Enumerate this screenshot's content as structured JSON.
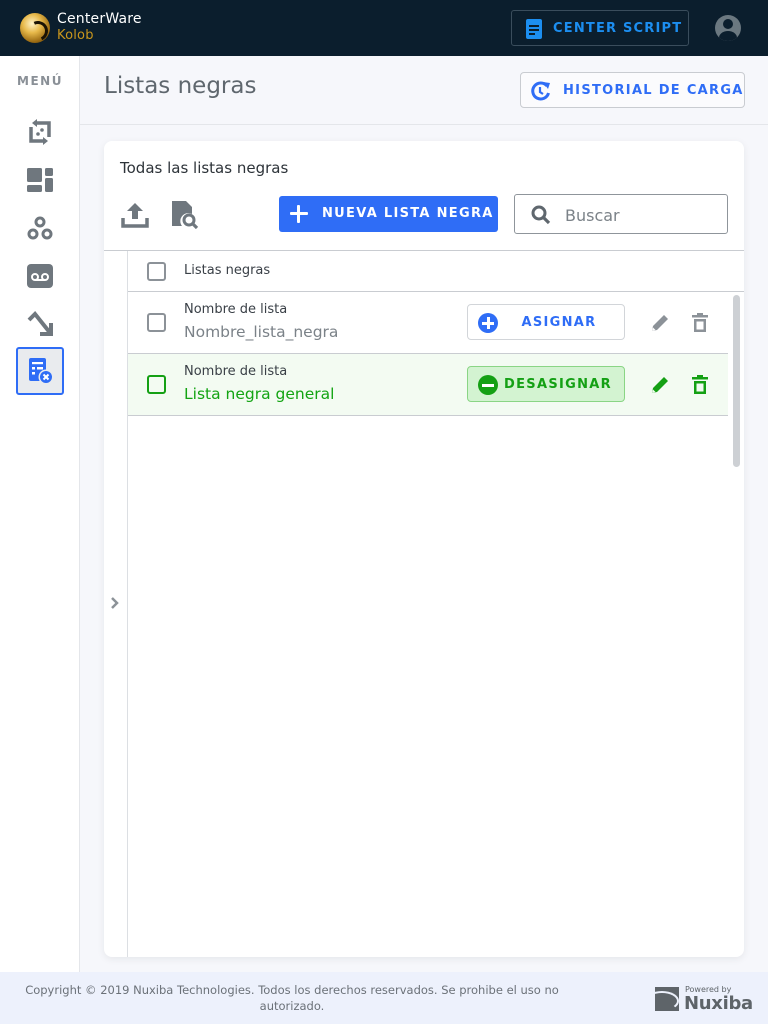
{
  "topbar": {
    "brand_name": "CenterWare",
    "brand_sub": "Kolob",
    "center_script_label": "CENTER SCRIPT",
    "colors": {
      "background": "#0b1e2d",
      "accent": "#1c8ef0",
      "brand_gold": "#c9961c"
    }
  },
  "sidebar": {
    "menu_label": "MENÚ",
    "items": [
      {
        "icon": "transfer-cycle-icon",
        "active": false
      },
      {
        "icon": "dashboard-icon",
        "active": false
      },
      {
        "icon": "groups-icon",
        "active": false
      },
      {
        "icon": "voicemail-icon",
        "active": false
      },
      {
        "icon": "call-split-icon",
        "active": false
      },
      {
        "icon": "blacklist-icon",
        "active": true
      }
    ]
  },
  "header": {
    "title": "Listas negras",
    "history_button_label": "HISTORIAL DE CARGA"
  },
  "card": {
    "title": "Todas las listas negras",
    "upload_icon": "upload-icon",
    "find_icon": "find-in-page-icon",
    "new_button_label": "NUEVA LISTA NEGRA",
    "search": {
      "placeholder": "Buscar",
      "value": ""
    }
  },
  "table": {
    "header_label": "Listas negras",
    "rows": [
      {
        "label": "Nombre de lista",
        "value": "Nombre_lista_negra",
        "assigned": false,
        "action_label": "ASIGNAR"
      },
      {
        "label": "Nombre de lista",
        "value": "Lista negra general",
        "assigned": true,
        "action_label": "DESASIGNAR"
      }
    ]
  },
  "colors": {
    "primary": "#2f6df6",
    "success": "#14a014",
    "success_bg": "#d3f3d1",
    "row_assigned_bg": "#f3fbf2"
  },
  "footer": {
    "copyright": "Copyright © 2019 Nuxiba Technologies. Todos los derechos reservados. Se prohibe el uso no autorizado.",
    "powered_by": "Powered by",
    "powered_brand": "Nuxiba"
  }
}
